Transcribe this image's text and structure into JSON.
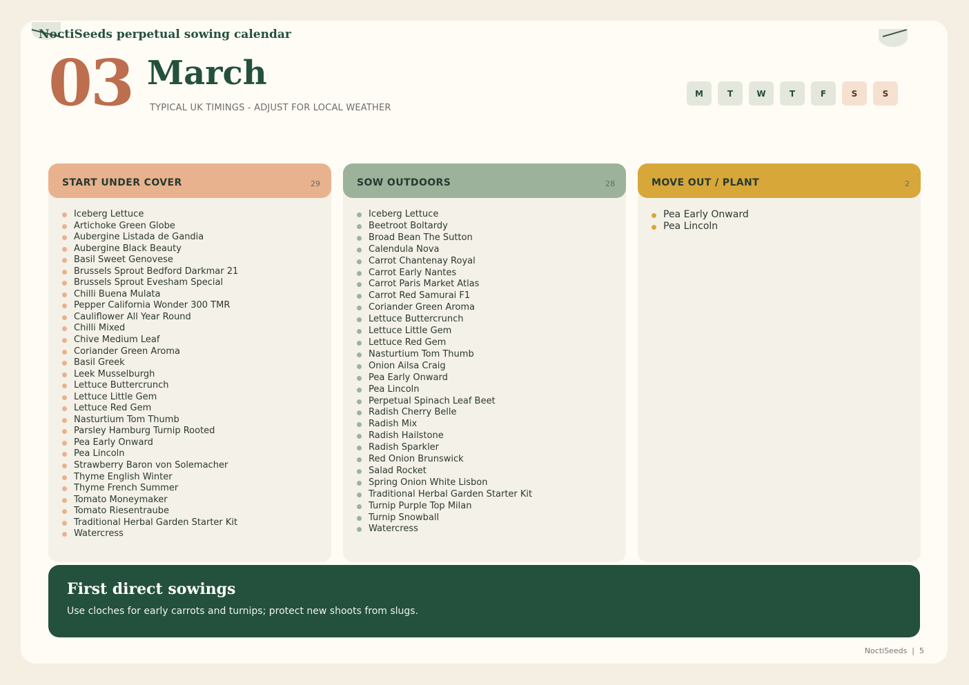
{
  "brand": "NoctiSeeds perpetual sowing calendar",
  "month": {
    "number": "03",
    "name": "March",
    "subtitle": "TYPICAL UK TIMINGS - ADJUST FOR LOCAL WEATHER"
  },
  "weekdays": [
    "M",
    "T",
    "W",
    "T",
    "F",
    "S",
    "S"
  ],
  "columns": [
    {
      "title": "START UNDER COVER",
      "count": "29",
      "items": [
        "Iceberg Lettuce",
        "Artichoke Green Globe",
        "Aubergine Listada de Gandia",
        "Aubergine Black Beauty",
        "Basil Sweet Genovese",
        "Brussels Sprout Bedford Darkmar 21",
        "Brussels Sprout Evesham Special",
        "Chilli Buena Mulata",
        "Pepper California Wonder 300 TMR",
        "Cauliflower All Year Round",
        "Chilli Mixed",
        "Chive Medium Leaf",
        "Coriander Green Aroma",
        "Basil Greek",
        "Leek Musselburgh",
        "Lettuce Buttercrunch",
        "Lettuce Little Gem",
        "Lettuce Red Gem",
        "Nasturtium Tom Thumb",
        "Parsley Hamburg Turnip Rooted",
        "Pea Early Onward",
        "Pea Lincoln",
        "Strawberry Baron von Solemacher",
        "Thyme English Winter",
        "Thyme French Summer",
        "Tomato Moneymaker",
        "Tomato Riesentraube",
        "Traditional Herbal Garden Starter Kit",
        "Watercress"
      ]
    },
    {
      "title": "SOW OUTDOORS",
      "count": "28",
      "items": [
        "Iceberg Lettuce",
        "Beetroot Boltardy",
        "Broad Bean The Sutton",
        "Calendula Nova",
        "Carrot Chantenay Royal",
        "Carrot Early Nantes",
        "Carrot Paris Market Atlas",
        "Carrot Red Samurai F1",
        "Coriander Green Aroma",
        "Lettuce Buttercrunch",
        "Lettuce Little Gem",
        "Lettuce Red Gem",
        "Nasturtium Tom Thumb",
        "Onion Ailsa Craig",
        "Pea Early Onward",
        "Pea Lincoln",
        "Perpetual Spinach Leaf Beet",
        "Radish Cherry Belle",
        "Radish Mix",
        "Radish Hailstone",
        "Radish Sparkler",
        "Red Onion Brunswick",
        "Salad Rocket",
        "Spring Onion White Lisbon",
        "Traditional Herbal Garden Starter Kit",
        "Turnip Purple Top Milan",
        "Turnip Snowball",
        "Watercress"
      ]
    },
    {
      "title": "MOVE OUT / PLANT",
      "count": "2",
      "items": [
        "Pea Early Onward",
        "Pea Lincoln"
      ]
    }
  ],
  "banner": {
    "title": "First direct sowings",
    "text": "Use cloches for early carrots and turnips; protect new shoots from slugs."
  },
  "footer": "NoctiSeeds  |  5",
  "colors": {
    "under_cover": "#e8b28f",
    "outdoors": "#9db29a",
    "move_out": "#d8a73a",
    "banner": "#24503e",
    "month_number": "#bc6e4f"
  }
}
